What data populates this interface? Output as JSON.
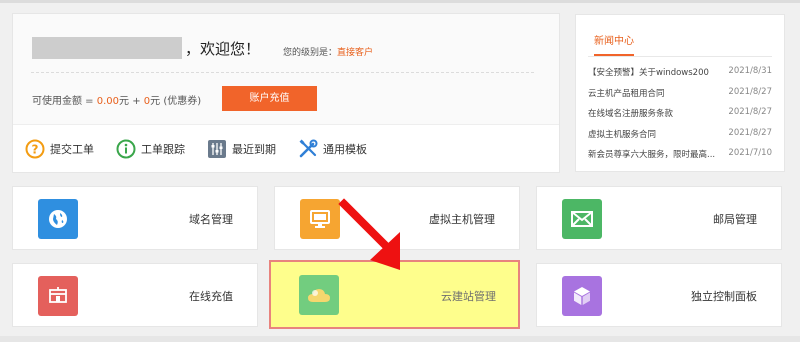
{
  "welcome": {
    "greeting": "，欢迎您！",
    "level_label": "您的级别是：",
    "level_value": "直接客户",
    "balance_prefix": "可使用金额 = ",
    "balance_amount": "0.00",
    "balance_mid": "元 + ",
    "balance_coupon": "0",
    "balance_suffix": "元 (优惠券)",
    "recharge_button": "账户充值"
  },
  "quick_links": [
    {
      "label": "提交工单",
      "icon": "question-circle-icon"
    },
    {
      "label": "工单跟踪",
      "icon": "info-circle-icon"
    },
    {
      "label": "最近到期",
      "icon": "sliders-icon"
    },
    {
      "label": "通用模板",
      "icon": "tools-icon"
    }
  ],
  "news": {
    "tab": "新闻中心",
    "items": [
      {
        "title": "【安全预警】关于windows200",
        "date": "2021/8/31"
      },
      {
        "title": "云主机产品租用合同",
        "date": "2021/8/27"
      },
      {
        "title": "在线域名注册服务条款",
        "date": "2021/8/27"
      },
      {
        "title": "虚拟主机服务合同",
        "date": "2021/8/27"
      },
      {
        "title": "新会员尊享六大服务，限时最高...",
        "date": "2021/7/10"
      }
    ]
  },
  "cards": [
    {
      "label": "域名管理",
      "icon": "globe-icon",
      "color": "#2f8fe0"
    },
    {
      "label": "虚拟主机管理",
      "icon": "monitor-icon",
      "color": "#f6a531"
    },
    {
      "label": "邮局管理",
      "icon": "mail-icon",
      "color": "#4cb765"
    },
    {
      "label": "在线充值",
      "icon": "recharge-icon",
      "color": "#e4605c"
    },
    {
      "label": "云建站管理",
      "icon": "cloud-icon",
      "color": "#72cd7f"
    },
    {
      "label": "独立控制面板",
      "icon": "cube-icon",
      "color": "#a873e0"
    }
  ],
  "colors": {
    "accent": "#f1642a",
    "highlight": "#fefe8c",
    "arrow": "#ee1111"
  }
}
